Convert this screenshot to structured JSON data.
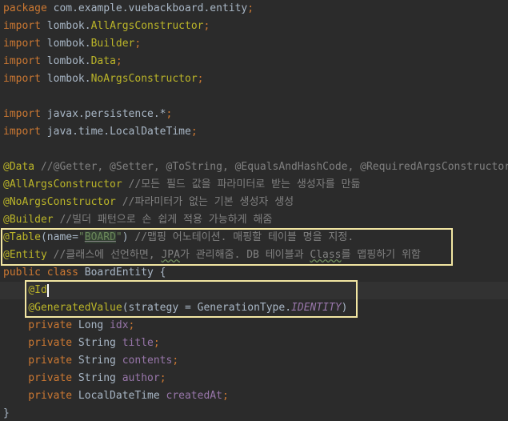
{
  "editor": {
    "lines": [
      {
        "segments": [
          {
            "t": "package ",
            "c": "kw"
          },
          {
            "t": "com.example.vuebackboard.entity",
            "c": "pl"
          },
          {
            "t": ";",
            "c": "kw"
          }
        ]
      },
      {
        "segments": [
          {
            "t": "import ",
            "c": "kw"
          },
          {
            "t": "lombok.",
            "c": "pl"
          },
          {
            "t": "AllArgsConstructor",
            "c": "ann"
          },
          {
            "t": ";",
            "c": "kw"
          }
        ]
      },
      {
        "segments": [
          {
            "t": "import ",
            "c": "kw"
          },
          {
            "t": "lombok.",
            "c": "pl"
          },
          {
            "t": "Builder",
            "c": "ann"
          },
          {
            "t": ";",
            "c": "kw"
          }
        ]
      },
      {
        "segments": [
          {
            "t": "import ",
            "c": "kw"
          },
          {
            "t": "lombok.",
            "c": "pl"
          },
          {
            "t": "Data",
            "c": "ann"
          },
          {
            "t": ";",
            "c": "kw"
          }
        ]
      },
      {
        "segments": [
          {
            "t": "import ",
            "c": "kw"
          },
          {
            "t": "lombok.",
            "c": "pl"
          },
          {
            "t": "NoArgsConstructor",
            "c": "ann"
          },
          {
            "t": ";",
            "c": "kw"
          }
        ]
      },
      {
        "segments": []
      },
      {
        "segments": [
          {
            "t": "import ",
            "c": "kw"
          },
          {
            "t": "javax.persistence.*",
            "c": "pl"
          },
          {
            "t": ";",
            "c": "kw"
          }
        ]
      },
      {
        "segments": [
          {
            "t": "import ",
            "c": "kw"
          },
          {
            "t": "java.time.LocalDateTime",
            "c": "pl"
          },
          {
            "t": ";",
            "c": "kw"
          }
        ]
      },
      {
        "segments": []
      },
      {
        "segments": [
          {
            "t": "@Data ",
            "c": "ann"
          },
          {
            "t": "//@Getter, @Setter, @ToString, @EqualsAndHashCode, @RequiredArgsConstructor",
            "c": "cm"
          }
        ]
      },
      {
        "segments": [
          {
            "t": "@AllArgsConstructor ",
            "c": "ann"
          },
          {
            "t": "//모든 필드 값을 파라미터로 받는 생성자를 만듦",
            "c": "cm"
          }
        ]
      },
      {
        "segments": [
          {
            "t": "@NoArgsConstructor ",
            "c": "ann"
          },
          {
            "t": "//파라미터가 없는 기본 생성자 생성",
            "c": "cm"
          }
        ]
      },
      {
        "segments": [
          {
            "t": "@Builder ",
            "c": "ann"
          },
          {
            "t": "//빌더 패턴으로 손 쉽게 적용 가능하게 해줌",
            "c": "cm"
          }
        ]
      },
      {
        "segments": [
          {
            "t": "@Table",
            "c": "ann"
          },
          {
            "t": "(name=",
            "c": "pl"
          },
          {
            "t": "\"",
            "c": "str"
          },
          {
            "t": "BOARD",
            "c": "str",
            "x": "hl-board"
          },
          {
            "t": "\"",
            "c": "str"
          },
          {
            "t": ") ",
            "c": "pl"
          },
          {
            "t": "//맵핑 어노테이션. 매핑할 테이블 명을 지정.",
            "c": "cm"
          }
        ]
      },
      {
        "segments": [
          {
            "t": "@Entity ",
            "c": "ann"
          },
          {
            "t": "//클래스에 선언하면, ",
            "c": "cm"
          },
          {
            "t": "JPA",
            "c": "cm",
            "x": "wavy"
          },
          {
            "t": "가 관리해줌. DB 테이블과 ",
            "c": "cm"
          },
          {
            "t": "Class",
            "c": "cm",
            "x": "wavy"
          },
          {
            "t": "를 맵핑하기 위함",
            "c": "cm"
          }
        ]
      },
      {
        "segments": [
          {
            "t": "public class ",
            "c": "kw"
          },
          {
            "t": "BoardEntity {",
            "c": "pl"
          }
        ]
      },
      {
        "segments": [
          {
            "t": "    ",
            "c": "pl"
          },
          {
            "t": "@Id",
            "c": "ann"
          }
        ],
        "caret": true
      },
      {
        "segments": [
          {
            "t": "    ",
            "c": "pl"
          },
          {
            "t": "@GeneratedValue",
            "c": "ann"
          },
          {
            "t": "(strategy = GenerationType.",
            "c": "pl"
          },
          {
            "t": "IDENTITY",
            "c": "en"
          },
          {
            "t": ")",
            "c": "pl"
          }
        ]
      },
      {
        "segments": [
          {
            "t": "    private ",
            "c": "kw"
          },
          {
            "t": "Long ",
            "c": "pl"
          },
          {
            "t": "idx",
            "c": "fld"
          },
          {
            "t": ";",
            "c": "kw"
          }
        ]
      },
      {
        "segments": [
          {
            "t": "    private ",
            "c": "kw"
          },
          {
            "t": "String ",
            "c": "pl"
          },
          {
            "t": "title",
            "c": "fld"
          },
          {
            "t": ";",
            "c": "kw"
          }
        ]
      },
      {
        "segments": [
          {
            "t": "    private ",
            "c": "kw"
          },
          {
            "t": "String ",
            "c": "pl"
          },
          {
            "t": "contents",
            "c": "fld"
          },
          {
            "t": ";",
            "c": "kw"
          }
        ]
      },
      {
        "segments": [
          {
            "t": "    private ",
            "c": "kw"
          },
          {
            "t": "String ",
            "c": "pl"
          },
          {
            "t": "author",
            "c": "fld"
          },
          {
            "t": ";",
            "c": "kw"
          }
        ]
      },
      {
        "segments": [
          {
            "t": "    private ",
            "c": "kw"
          },
          {
            "t": "LocalDateTime ",
            "c": "pl"
          },
          {
            "t": "createdAt",
            "c": "fld"
          },
          {
            "t": ";",
            "c": "kw"
          }
        ]
      },
      {
        "segments": [
          {
            "t": "}",
            "c": "pl"
          }
        ]
      }
    ]
  },
  "colors": {
    "background": "#2b2b2b",
    "keyword": "#cc7832",
    "annotation": "#bbb529",
    "comment": "#808080",
    "string": "#6a8759",
    "field": "#9876aa",
    "plain": "#a9b7c6",
    "highlight_box": "#f2e6a2"
  }
}
